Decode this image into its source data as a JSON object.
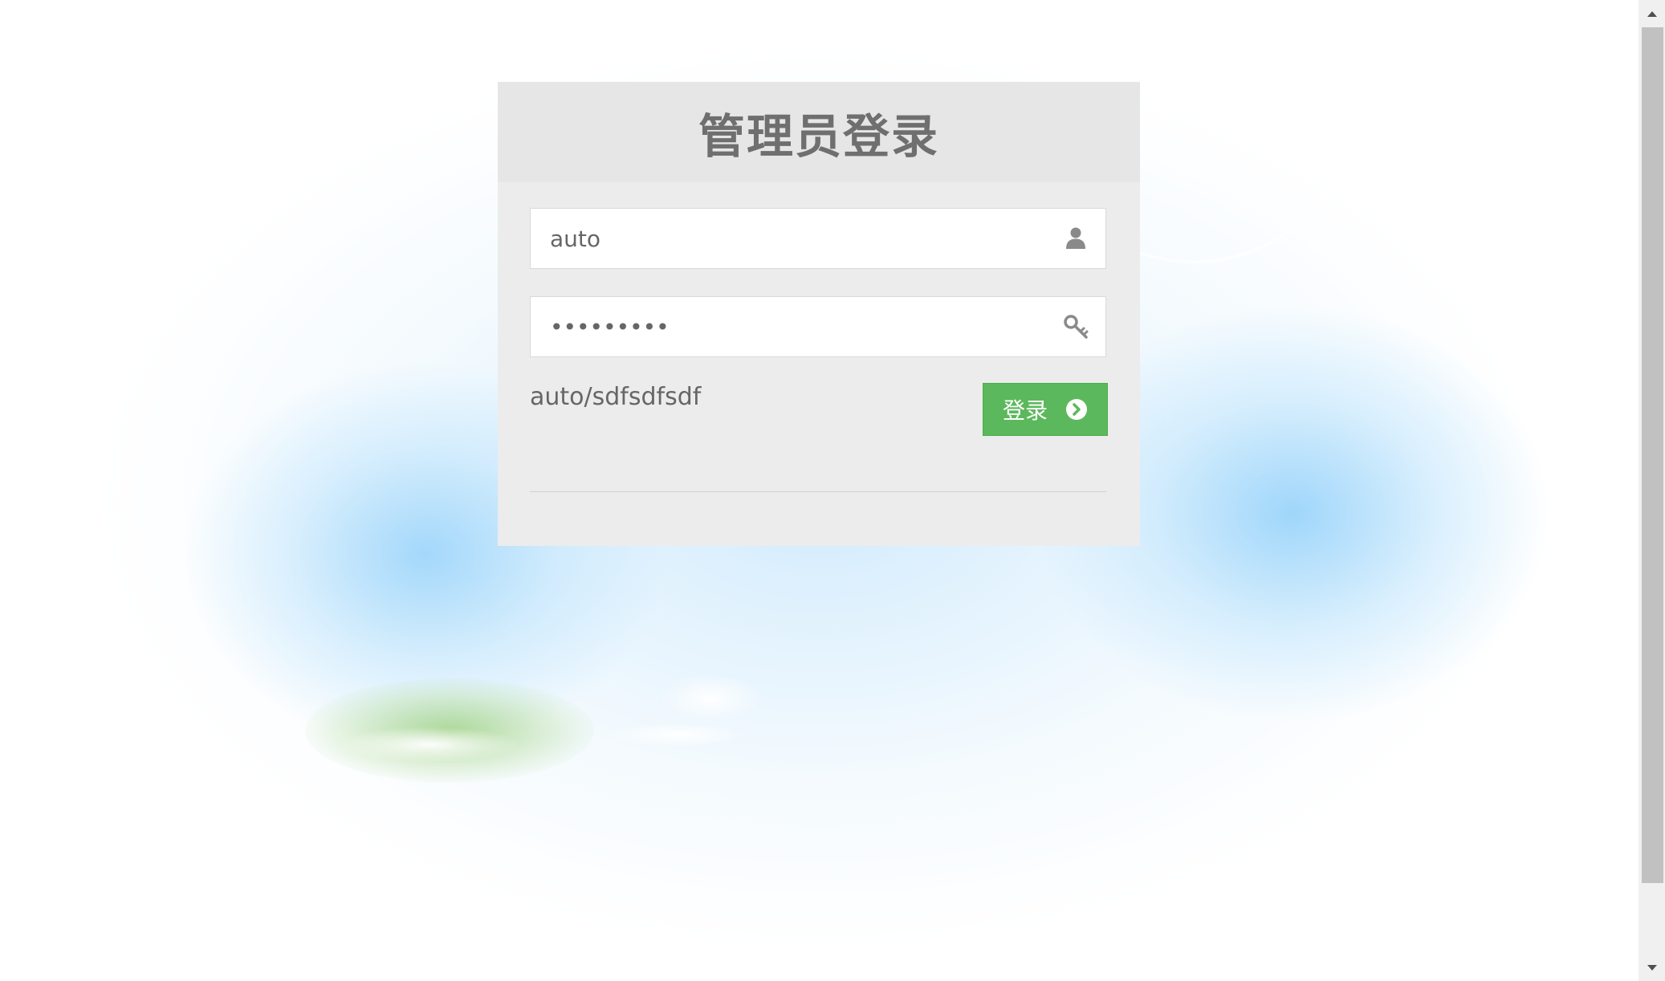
{
  "login": {
    "title": "管理员登录",
    "username_value": "auto",
    "password_value": "sdfsdfsdf",
    "hint": "auto/sdfsdfsdf",
    "button_label": "登录"
  },
  "icons": {
    "username": "user-icon",
    "password": "key-icon",
    "button": "chevron-right-circle-icon"
  },
  "colors": {
    "button": "#5cb85c",
    "panel": "#ececec",
    "title": "#6f6f6f"
  }
}
